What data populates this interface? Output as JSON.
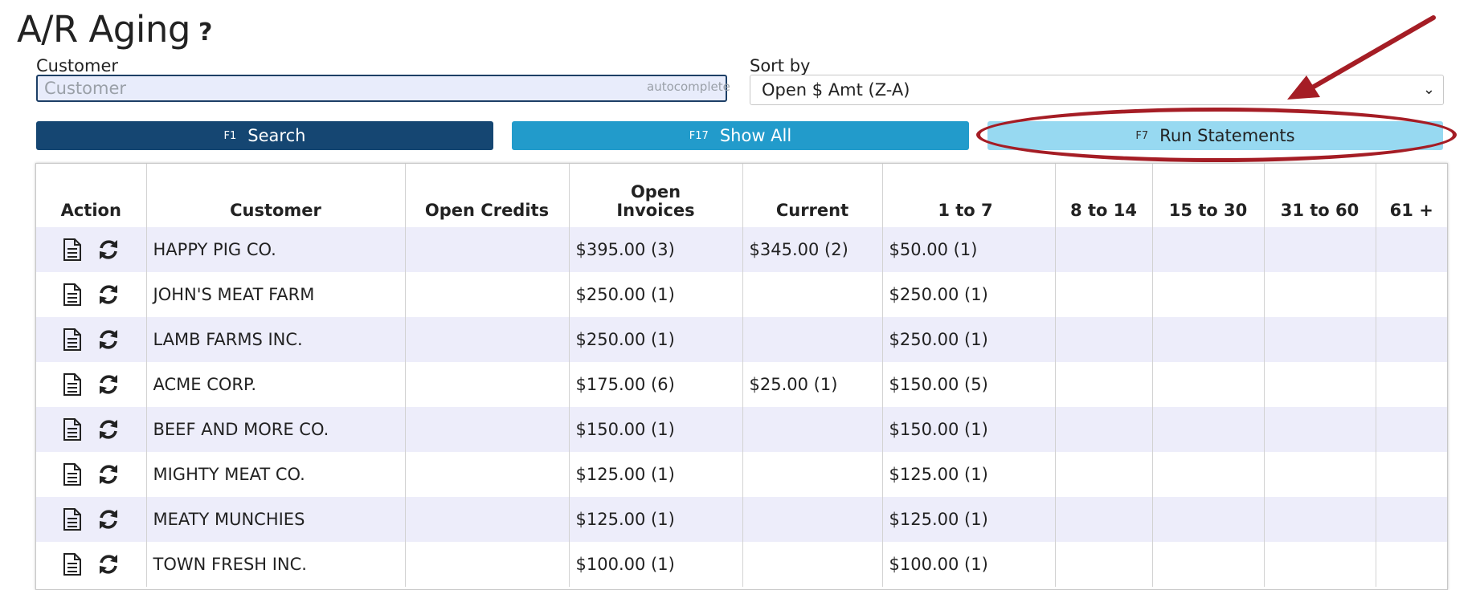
{
  "header": {
    "title": "A/R Aging",
    "help_icon": "?"
  },
  "filters": {
    "customer_label": "Customer",
    "customer_placeholder": "Customer",
    "customer_value": "",
    "autocomplete_tag": "autocomplete",
    "sort_label": "Sort by",
    "sort_value": "Open $ Amt (Z-A)"
  },
  "buttons": {
    "search": {
      "fkey": "F1",
      "label": "Search"
    },
    "show_all": {
      "fkey": "F17",
      "label": "Show All"
    },
    "run_statements": {
      "fkey": "F7",
      "label": "Run Statements"
    }
  },
  "annotation": {
    "color": "#a51d25"
  },
  "table": {
    "columns": [
      "Action",
      "Customer",
      "Open Credits",
      "Open Invoices",
      "Current",
      "1 to 7",
      "8 to 14",
      "15 to 30",
      "31 to 60",
      "61 +"
    ],
    "rows": [
      {
        "customer": "HAPPY PIG CO.",
        "open_credits": "",
        "open_invoices": "$395.00 (3)",
        "current": "$345.00 (2)",
        "d1_7": "$50.00 (1)",
        "d8_14": "",
        "d15_30": "",
        "d31_60": "",
        "d61": ""
      },
      {
        "customer": "JOHN'S MEAT FARM",
        "open_credits": "",
        "open_invoices": "$250.00 (1)",
        "current": "",
        "d1_7": "$250.00 (1)",
        "d8_14": "",
        "d15_30": "",
        "d31_60": "",
        "d61": ""
      },
      {
        "customer": "LAMB FARMS INC.",
        "open_credits": "",
        "open_invoices": "$250.00 (1)",
        "current": "",
        "d1_7": "$250.00 (1)",
        "d8_14": "",
        "d15_30": "",
        "d31_60": "",
        "d61": ""
      },
      {
        "customer": "ACME CORP.",
        "open_credits": "",
        "open_invoices": "$175.00 (6)",
        "current": "$25.00 (1)",
        "d1_7": "$150.00 (5)",
        "d8_14": "",
        "d15_30": "",
        "d31_60": "",
        "d61": ""
      },
      {
        "customer": "BEEF AND MORE CO.",
        "open_credits": "",
        "open_invoices": "$150.00 (1)",
        "current": "",
        "d1_7": "$150.00 (1)",
        "d8_14": "",
        "d15_30": "",
        "d31_60": "",
        "d61": ""
      },
      {
        "customer": "MIGHTY MEAT CO.",
        "open_credits": "",
        "open_invoices": "$125.00 (1)",
        "current": "",
        "d1_7": "$125.00 (1)",
        "d8_14": "",
        "d15_30": "",
        "d31_60": "",
        "d61": ""
      },
      {
        "customer": "MEATY MUNCHIES",
        "open_credits": "",
        "open_invoices": "$125.00 (1)",
        "current": "",
        "d1_7": "$125.00 (1)",
        "d8_14": "",
        "d15_30": "",
        "d31_60": "",
        "d61": ""
      },
      {
        "customer": "TOWN FRESH INC.",
        "open_credits": "",
        "open_invoices": "$100.00 (1)",
        "current": "",
        "d1_7": "$100.00 (1)",
        "d8_14": "",
        "d15_30": "",
        "d31_60": "",
        "d61": ""
      }
    ],
    "row_actions": [
      "document-icon",
      "refresh-icon"
    ]
  }
}
